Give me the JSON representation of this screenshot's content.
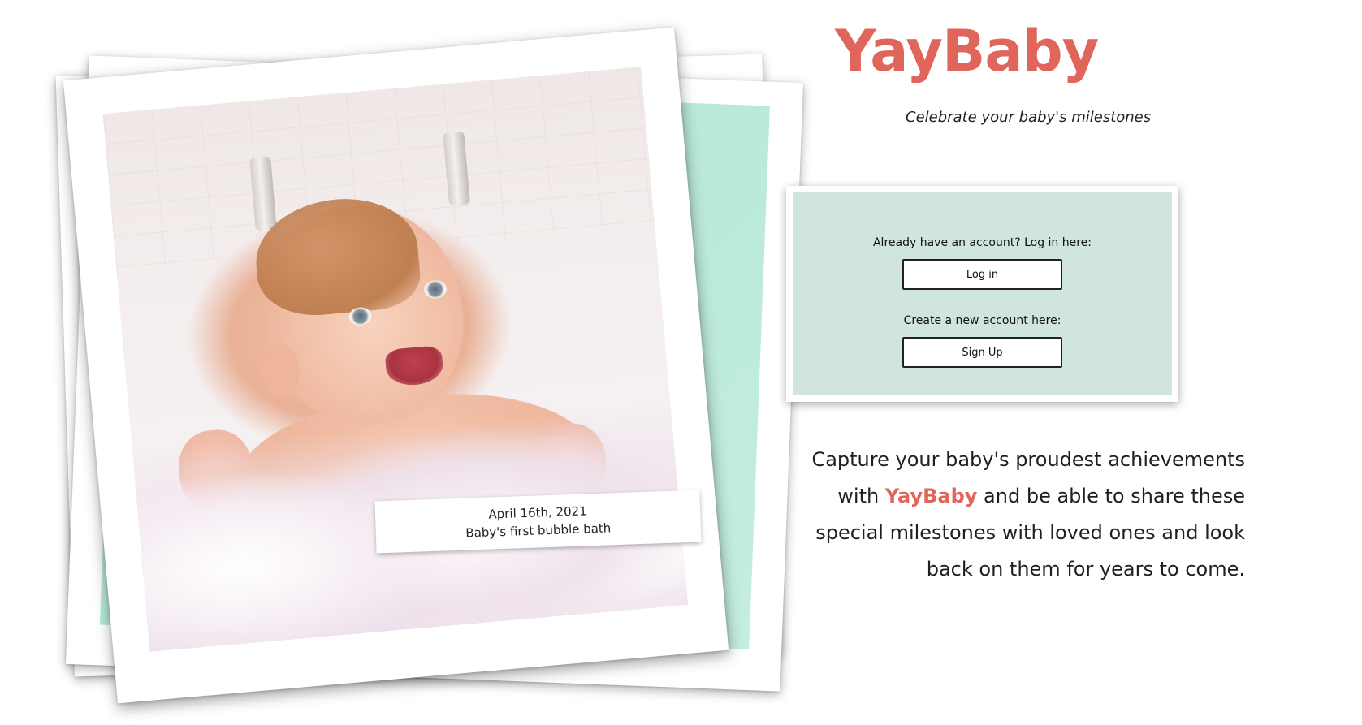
{
  "brand": {
    "name": "YayBaby",
    "tagline": "Celebrate your baby's milestones",
    "accent_color": "#e0655a"
  },
  "photo": {
    "caption_date": "April 16th, 2021",
    "caption_text": "Baby's first bubble bath",
    "frame_accent_color": "#c4eedf"
  },
  "auth": {
    "login_prompt": "Already have an account? Log in here:",
    "login_button": "Log in",
    "signup_prompt": "Create a new account here:",
    "signup_button": "Sign Up",
    "panel_color": "#cfe5de"
  },
  "blurb": {
    "before": "Capture your baby's proudest achievements with ",
    "highlight": "YayBaby",
    "after": " and be able to share these special milestones with loved ones and look back on them for years to come."
  }
}
